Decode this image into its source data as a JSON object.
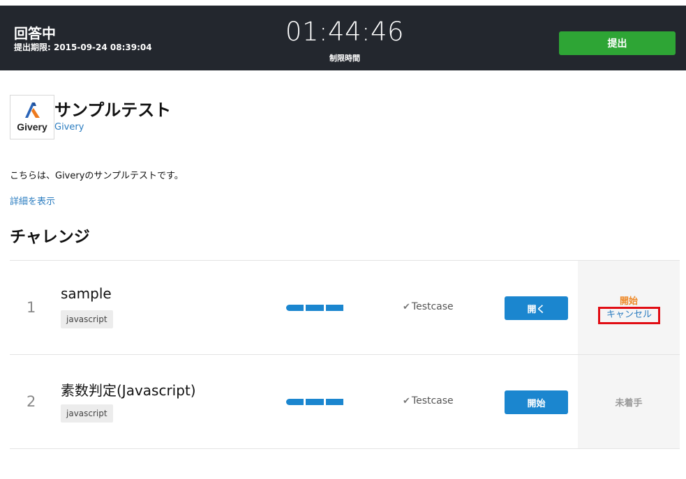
{
  "header": {
    "status_title": "回答中",
    "deadline": "提出期限: 2015-09-24 08:39:04",
    "timer": "01:44:46",
    "timer_label": "制限時間",
    "submit_label": "提出"
  },
  "test": {
    "logo_text": "Givery",
    "title": "サンプルテスト",
    "company": "Givery",
    "description": "こちらは、Giveryのサンプルテストです。",
    "detail_link": "詳細を表示"
  },
  "challenges": {
    "section_title": "チャレンジ",
    "rows": [
      {
        "number": "1",
        "name": "sample",
        "tag": "javascript",
        "testcase": "Testcase",
        "action_label": "開く",
        "status": "開始",
        "cancel_label": "キャンセル"
      },
      {
        "number": "2",
        "name": "素数判定(Javascript)",
        "tag": "javascript",
        "testcase": "Testcase",
        "action_label": "開始",
        "status": "未着手"
      }
    ]
  },
  "colors": {
    "header_bg": "#23272e",
    "submit_green": "#2ea535",
    "primary_blue": "#1b86cf",
    "link_blue": "#2a7cc0",
    "status_orange": "#ee8a2a",
    "highlight_red": "#e10d14"
  }
}
